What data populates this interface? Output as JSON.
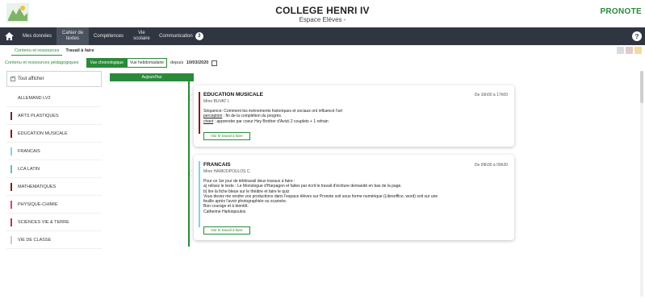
{
  "header": {
    "title": "COLLEGE HENRI IV",
    "subtitle": "Espace Elèves -",
    "brand": "PRONOTE"
  },
  "nav": {
    "items": [
      {
        "label": "Mes données",
        "active": false
      },
      {
        "label": "Cahier de textes",
        "active": true
      },
      {
        "label": "Compétences",
        "active": false
      },
      {
        "label": "Vie scolaire",
        "active": false
      },
      {
        "label": "Communication",
        "active": false,
        "badge": "3"
      }
    ],
    "help": "?"
  },
  "subtabs": [
    {
      "label": "Contenu et ressources",
      "active": true
    },
    {
      "label": "Travail à faire",
      "active": false,
      "bold": true
    }
  ],
  "filter": {
    "label": "Contenu et ressources pédagogiques",
    "toggle_chrono": "Vue chronologique",
    "toggle_weekly": "Vue hebdomadaire",
    "since_label": "depuis",
    "since_date": "10/03/2020"
  },
  "sidebar": {
    "show_all": "Tout afficher",
    "subjects": [
      {
        "label": "ALLEMAND LV2",
        "color": "#ffffff"
      },
      {
        "label": "ARTS PLASTIQUES",
        "color": "#6b2b2b"
      },
      {
        "label": "EDUCATION MUSICALE",
        "color": "#8b1a1a"
      },
      {
        "label": "FRANCAIS",
        "color": "#7dd3e8"
      },
      {
        "label": "LCA LATIN",
        "color": "#6fb8c8"
      },
      {
        "label": "MATHEMATIQUES",
        "color": "#7a1f1f"
      },
      {
        "label": "PHYSIQUE-CHIMIE",
        "color": "#d04a6a"
      },
      {
        "label": "SCIENCES VIE & TERRE",
        "color": "#c0304a"
      },
      {
        "label": "VIE DE CLASSE",
        "color": "#cccccc"
      }
    ]
  },
  "timeline": {
    "day": "Aujourd'hui"
  },
  "cards": [
    {
      "subject": "EDUCATION MUSICALE",
      "teacher": "Mme BUVAT I.",
      "time": "De 16h00 à 17h00",
      "accent": "#8b1a1a",
      "lines": [
        {
          "type": "plain",
          "text": "Séquence: Comment les évènements historiques et sociaux ont influencé l'art"
        },
        {
          "type": "labeled",
          "label": "perception",
          "text": " : fin de la complétion du progrès."
        },
        {
          "type": "labeled",
          "label": "chant",
          "text": " : apprendre par coeur Hey Brother d'Avicii 2 couplets + 1 refrain"
        }
      ],
      "button": "Voir le travail à faire"
    },
    {
      "subject": "FRANCAIS",
      "teacher": "Mme HARKIOPOULOS C.",
      "time": "De 09h30 à 09h30",
      "accent": "#7dd3e8",
      "lines": [
        {
          "type": "plain",
          "text": "Pour ce 1er jour de télétravail deux travaux à faire :"
        },
        {
          "type": "plain",
          "text": "a) relisez le texte : Le Monologue d'Harpagon et faites par écrit le travail d'écriture demandé en bas de la page."
        },
        {
          "type": "plain",
          "text": "b) lire la fiche bleue sur le théâtre et faire le quiz"
        },
        {
          "type": "plain",
          "text": "Vous devez me rendre vos productions dans l'espace élèves sur Pronote soit sous forme numérique (Libreoffice, word) soit sur une"
        },
        {
          "type": "plain",
          "text": "feuille après l'avoir photographiée ou scannée."
        },
        {
          "type": "plain",
          "text": "Bon courage et à bientôt."
        },
        {
          "type": "plain",
          "text": "Catherine Harkiopoulos"
        }
      ],
      "button": "Voir le travail à faire"
    }
  ],
  "colors": {
    "accent": "#2a8a3a",
    "nav_bg": "#2f3640"
  }
}
